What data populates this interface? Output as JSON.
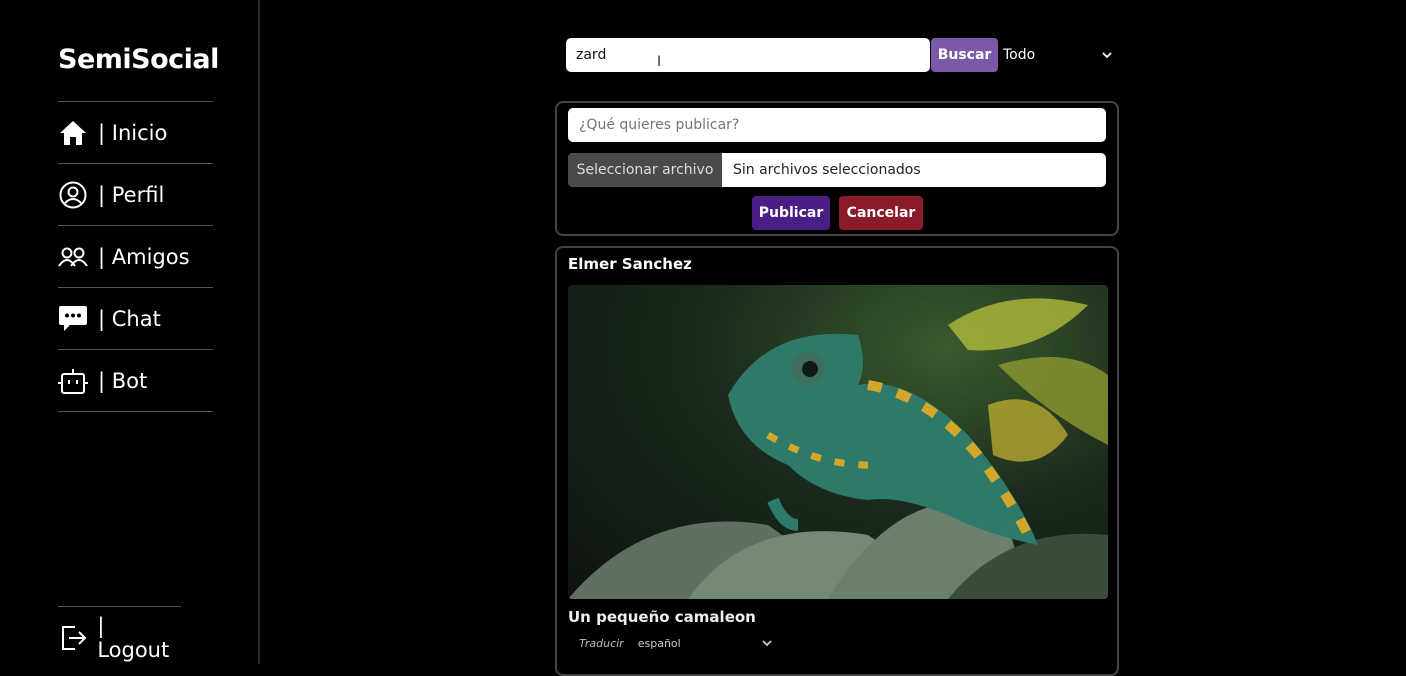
{
  "app": {
    "brand": "SemiSocial"
  },
  "sidebar": {
    "items": [
      {
        "label": "| Inicio",
        "icon": "home-icon"
      },
      {
        "label": "| Perfil",
        "icon": "user-circle-icon"
      },
      {
        "label": "| Amigos",
        "icon": "users-icon"
      },
      {
        "label": "| Chat",
        "icon": "chat-bubble-icon"
      },
      {
        "label": "| Bot",
        "icon": "robot-icon"
      }
    ],
    "logout": {
      "label": "| Logout",
      "icon": "logout-icon"
    }
  },
  "search": {
    "value": "zard",
    "button_label": "Buscar",
    "filter_value": "Todo"
  },
  "composer": {
    "placeholder": "¿Qué quieres publicar?",
    "file_button_label": "Seleccionar archivo",
    "file_status": "Sin archivos seleccionados",
    "publish_label": "Publicar",
    "cancel_label": "Cancelar"
  },
  "post": {
    "author": "Elmer Sanchez",
    "image_alt": "chameleon-photo",
    "caption": "Un pequeño camaleon",
    "translate_label": "Traducir",
    "language_value": "español"
  },
  "colors": {
    "background": "#000000",
    "search_button": "#7a5aa6",
    "publish_button": "#4a1f85",
    "cancel_button": "#8b1a2b"
  }
}
